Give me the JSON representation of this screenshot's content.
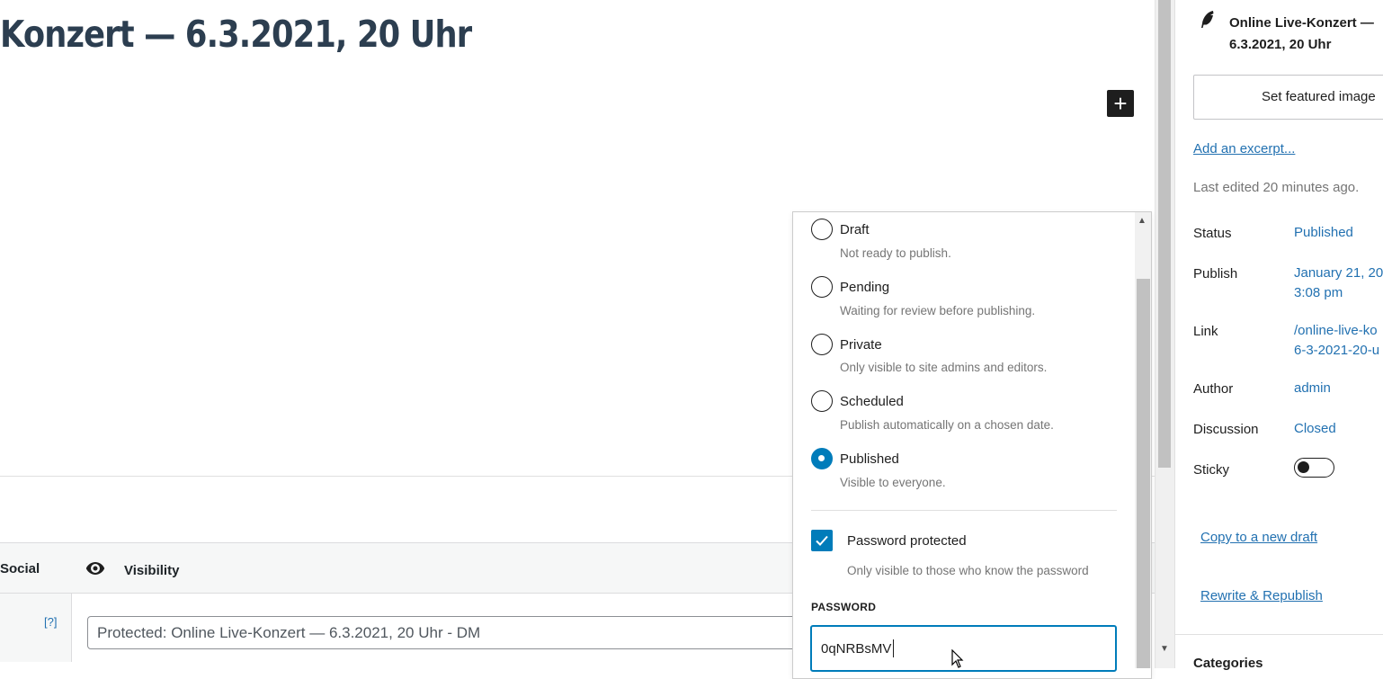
{
  "editor": {
    "title": "Konzert — 6.3.2021, 20 Uhr",
    "add_block_label": "+"
  },
  "meta_box": {
    "tabs": {
      "social": "Social",
      "visibility": "Visibility"
    },
    "help_link": "[?]",
    "og_title_value": "Protected: Online Live-Konzert — 6.3.2021, 20 Uhr - DM"
  },
  "status_popover": {
    "options": [
      {
        "label": "Draft",
        "description": "Not ready to publish.",
        "checked": false
      },
      {
        "label": "Pending",
        "description": "Waiting for review before publishing.",
        "checked": false
      },
      {
        "label": "Private",
        "description": "Only visible to site admins and editors.",
        "checked": false
      },
      {
        "label": "Scheduled",
        "description": "Publish automatically on a chosen date.",
        "checked": false
      },
      {
        "label": "Published",
        "description": "Visible to everyone.",
        "checked": true
      }
    ],
    "password_checkbox_label": "Password protected",
    "password_checkbox_description": "Only visible to those who know the password",
    "password_checked": true,
    "password_heading": "PASSWORD",
    "password_value": "0qNRBsMV"
  },
  "sidebar": {
    "post_title": "Online Live-Konzert — 6.3.2021, 20 Uhr",
    "featured_image_button": "Set featured image",
    "excerpt_link": "Add an excerpt...",
    "last_edited": "Last edited 20 minutes ago.",
    "rows": {
      "status_label": "Status",
      "status_value": "Published",
      "publish_label": "Publish",
      "publish_value_line1": "January 21, 20",
      "publish_value_line2": "3:08 pm",
      "link_label": "Link",
      "link_value_line1": "/online-live-ko",
      "link_value_line2": "6-3-2021-20-u",
      "author_label": "Author",
      "author_value": "admin",
      "discussion_label": "Discussion",
      "discussion_value": "Closed",
      "sticky_label": "Sticky",
      "sticky_on": false
    },
    "copy_draft_link": "Copy to a new draft",
    "rewrite_link": "Rewrite & Republish",
    "categories_heading": "Categories"
  },
  "colors": {
    "accent": "#007cba",
    "link": "#2271b1",
    "title": "#2c3e50"
  }
}
